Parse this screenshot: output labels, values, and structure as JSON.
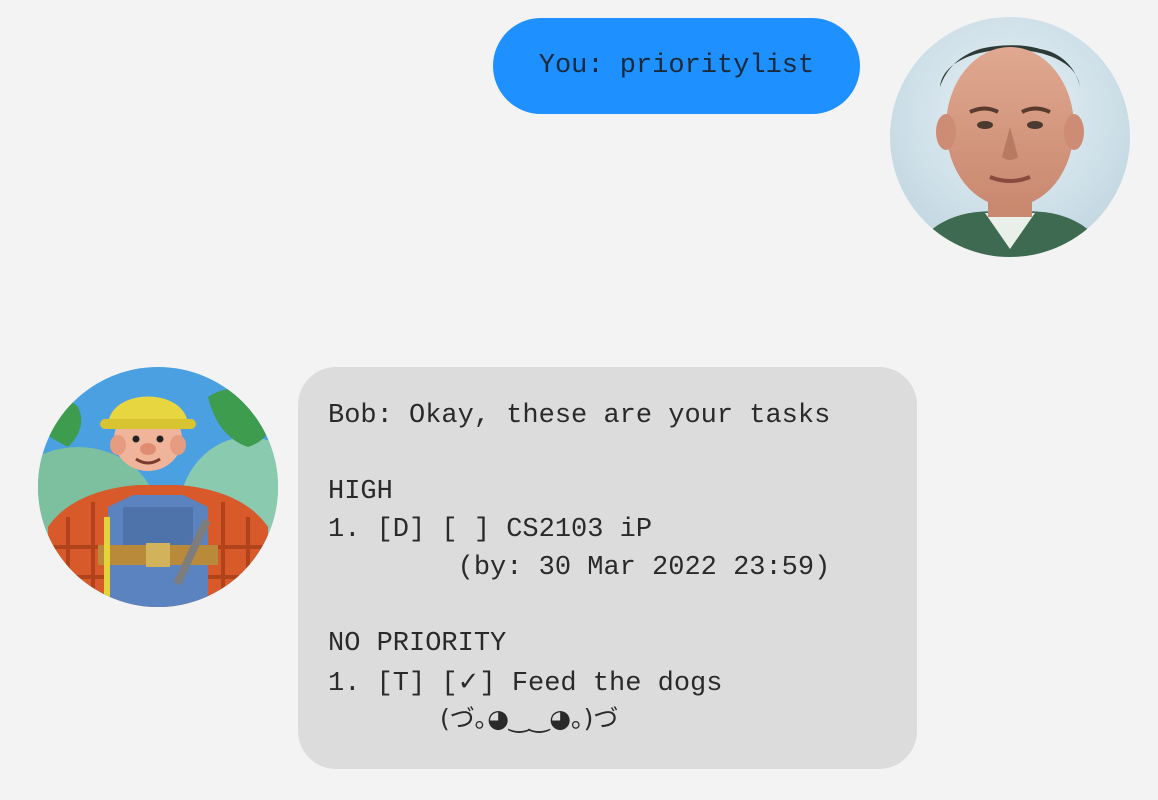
{
  "user_message": {
    "text": "You: prioritylist",
    "accent": "#1e90ff"
  },
  "user_avatar": {
    "icon": "user-portrait-avatar"
  },
  "bot_avatar": {
    "icon": "builder-bob-avatar"
  },
  "bot_message": {
    "header": "Bob: Okay, these are your tasks",
    "high_label": "HIGH",
    "high_task_line": "1. [D] [ ] CS2103 iP",
    "high_task_deadline": "        (by: 30 Mar 2022 23:59)",
    "none_label": "NO PRIORITY",
    "none_task_prefix": "1. [T] [",
    "none_task_check": "✓",
    "none_task_suffix": "] Feed the dogs",
    "kaomoji": "(づ｡◕‿‿◕｡)づ",
    "bubble_color": "#dcdcdc"
  }
}
